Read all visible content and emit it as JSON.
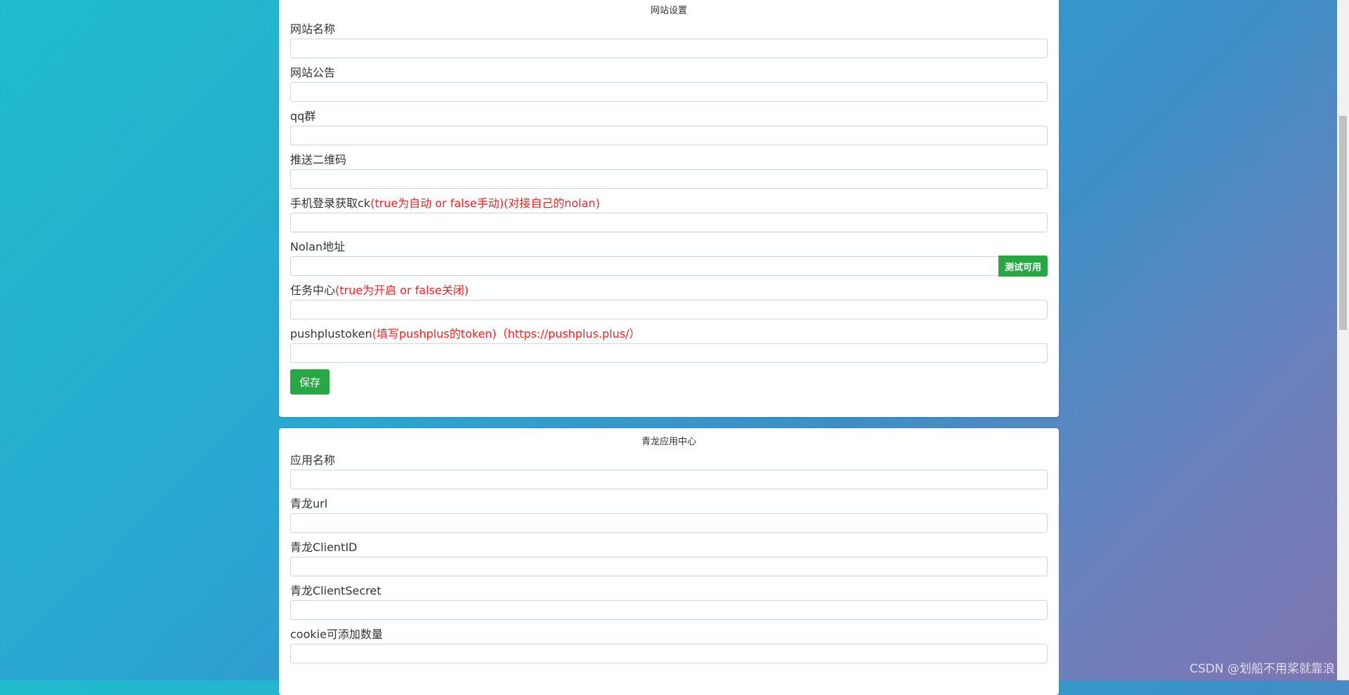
{
  "website_settings": {
    "title": "网站设置",
    "fields": [
      {
        "label": "网站名称",
        "hint": "",
        "value": ""
      },
      {
        "label": "网站公告",
        "hint": "",
        "value": ""
      },
      {
        "label": "qq群",
        "hint": "",
        "value": ""
      },
      {
        "label": "推送二维码",
        "hint": "",
        "value": ""
      },
      {
        "label": "手机登录获取ck",
        "hint": "(true为自动 or false手动)(对接自己的nolan)",
        "value": ""
      },
      {
        "label": "Nolan地址",
        "hint": "",
        "value": "",
        "button": "测试可用"
      },
      {
        "label": "任务中心",
        "hint": "(true为开启 or false关闭)",
        "value": ""
      },
      {
        "label": "pushplustoken",
        "hint": "(填写pushplus的token)（https://pushplus.plus/）",
        "value": ""
      }
    ],
    "save_label": "保存"
  },
  "qinglong_center": {
    "title": "青龙应用中心",
    "fields": [
      {
        "label": "应用名称",
        "value": ""
      },
      {
        "label": "青龙url",
        "value": ""
      },
      {
        "label": "青龙ClientID",
        "value": ""
      },
      {
        "label": "青龙ClientSecret",
        "value": ""
      },
      {
        "label": "cookie可添加数量",
        "value": ""
      }
    ]
  },
  "watermark": "CSDN @划船不用桨就靠浪",
  "colors": {
    "accent_green": "#28a745",
    "hint_red": "#ff1e1e"
  }
}
